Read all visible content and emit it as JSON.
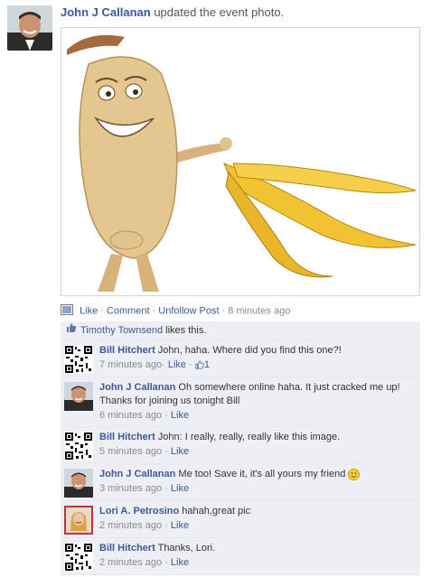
{
  "story": {
    "author": "John J Callanan",
    "action": " updated the event photo."
  },
  "actions": {
    "like": "Like",
    "comment": "Comment",
    "unfollow": "Unfollow Post",
    "time": "8 minutes ago"
  },
  "likes": {
    "name": "Timothy Townsend",
    "suffix": " likes this."
  },
  "comments": [
    {
      "author": "Bill Hitchert",
      "text": "John, haha. Where did you find this one?!",
      "time": "7 minutes ago",
      "like": "Like",
      "like_count": "1"
    },
    {
      "author": "John J Callanan",
      "text": "Oh somewhere online haha. It just cracked me up! Thanks for joining us tonight Bill",
      "time": "6 minutes ago",
      "like": "Like"
    },
    {
      "author": "Bill Hitchert",
      "text": "John: I really, really, really like this image.",
      "time": "5 minutes ago",
      "like": "Like"
    },
    {
      "author": "John J Callanan",
      "text": "Me too! Save it, it's all yours my friend",
      "time": "3 minutes ago",
      "like": "Like"
    },
    {
      "author": "Lori A. Petrosino",
      "text": "hahah,great pic",
      "time": "2 minutes ago",
      "like": "Like"
    },
    {
      "author": "Bill Hitchert",
      "text": "Thanks, Lori.",
      "time": "2 minutes ago",
      "like": "Like"
    }
  ],
  "separator": "·",
  "colors": {
    "link": "#3b5998",
    "ufi_bg": "#edeff4",
    "meta": "#8b8b8b"
  }
}
